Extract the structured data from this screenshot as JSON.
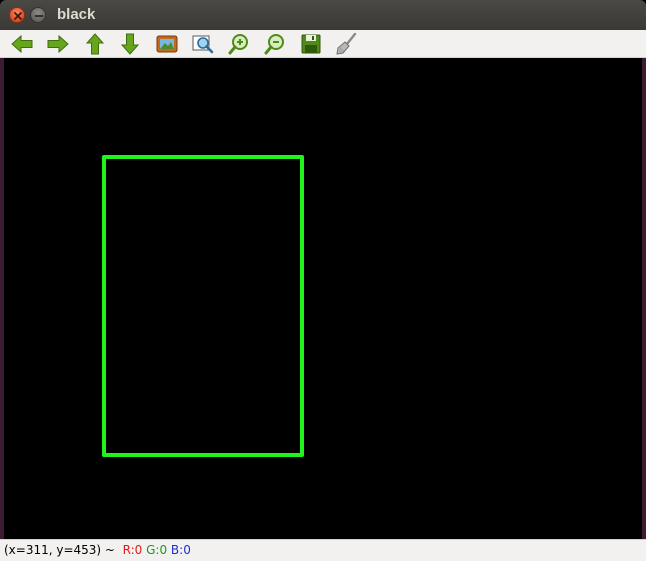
{
  "window": {
    "title": "black"
  },
  "toolbar": {
    "buttons": [
      {
        "name": "pan-left-button",
        "icon": "arrow-left-icon"
      },
      {
        "name": "pan-right-button",
        "icon": "arrow-right-icon"
      },
      {
        "name": "pan-up-button",
        "icon": "arrow-up-icon"
      },
      {
        "name": "pan-down-button",
        "icon": "arrow-down-icon"
      },
      {
        "name": "zoom-original-button",
        "icon": "image-icon"
      },
      {
        "name": "zoom-fit-button",
        "icon": "zoom-region-icon"
      },
      {
        "name": "zoom-in-button",
        "icon": "zoom-in-icon"
      },
      {
        "name": "zoom-out-button",
        "icon": "zoom-out-icon"
      },
      {
        "name": "save-button",
        "icon": "floppy-disk-icon"
      },
      {
        "name": "properties-button",
        "icon": "brush-icon"
      }
    ]
  },
  "status": {
    "coords": "(x=311, y=453) ~ ",
    "r": "R:0",
    "g": "G:0",
    "b": "B:0"
  },
  "colors": {
    "canvas_background": "#000000",
    "rectangle_stroke": "#1ff51c"
  }
}
